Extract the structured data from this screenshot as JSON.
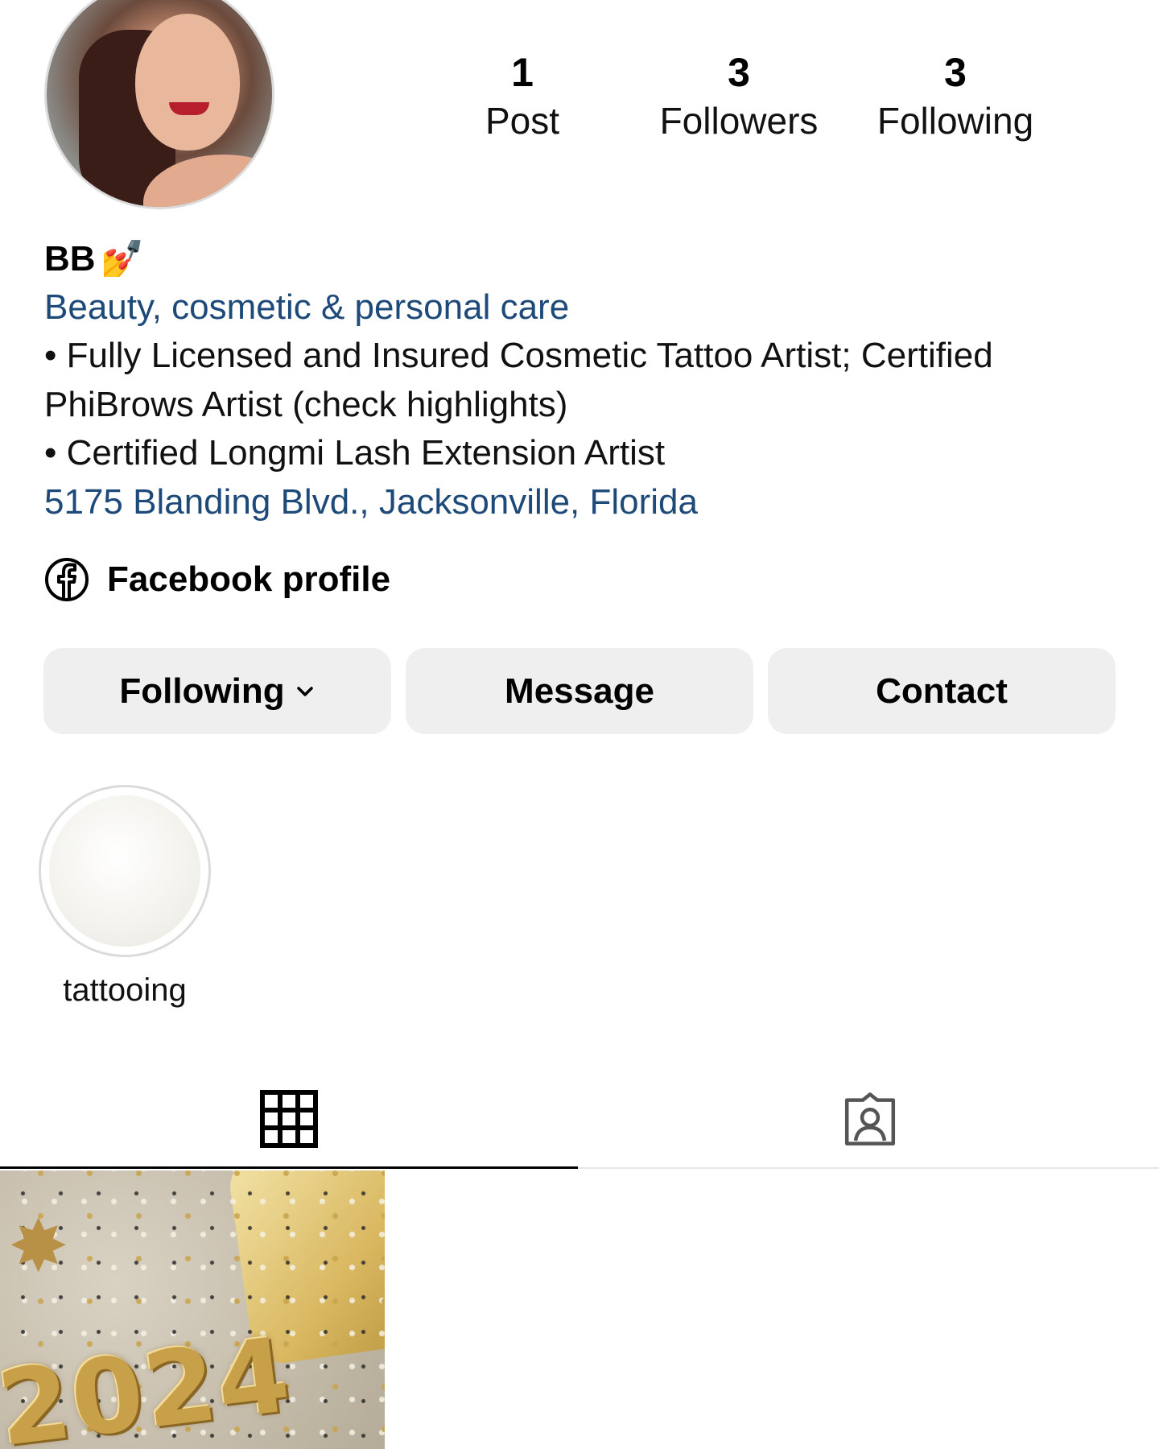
{
  "profile": {
    "name": "BB",
    "name_emoji": "💅",
    "category": "Beauty, cosmetic & personal care",
    "bio_lines": [
      "• Fully Licensed and Insured Cosmetic Tattoo Artist; Certified PhiBrows Artist (check highlights)",
      "• Certified Longmi Lash Extension Artist"
    ],
    "address": "5175 Blanding Blvd., Jacksonville, Florida",
    "facebook_label": "Facebook profile"
  },
  "stats": {
    "posts": {
      "count": "1",
      "label": "Post"
    },
    "followers": {
      "count": "3",
      "label": "Followers"
    },
    "following": {
      "count": "3",
      "label": "Following"
    }
  },
  "actions": {
    "following_label": "Following",
    "message_label": "Message",
    "contact_label": "Contact"
  },
  "highlights": [
    {
      "label": "tattooing"
    }
  ],
  "tabs": {
    "grid_icon": "grid-icon",
    "tagged_icon": "tagged-person-icon"
  },
  "posts": [
    {
      "caption_text": "2024"
    }
  ],
  "colors": {
    "link_blue": "#1e4a7a",
    "button_bg": "#efefef",
    "divider": "#e6e6e6"
  }
}
